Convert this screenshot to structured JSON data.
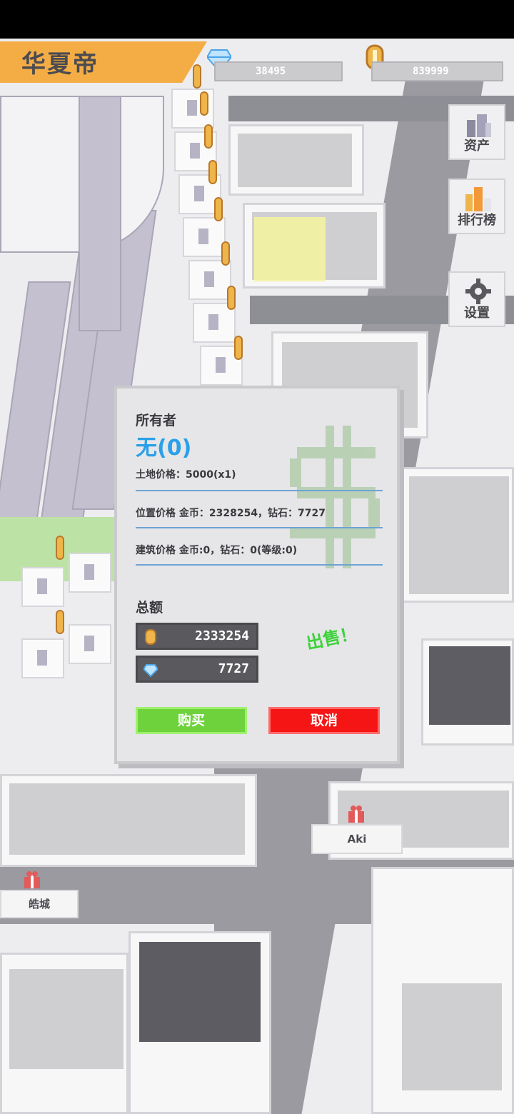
{
  "header": {
    "title": "华夏帝"
  },
  "resources": {
    "diamonds": "38495",
    "coins": "839999"
  },
  "side_menu": {
    "assets_label": "资产",
    "leaderboard_label": "排行榜",
    "settings_label": "设置"
  },
  "map_labels": {
    "player_aki": "Aki",
    "player_haocheng": "皓城"
  },
  "dialog": {
    "owner_label": "所有者",
    "owner_value": "无(0)",
    "land_price": "土地价格：5000(x1)",
    "location_price": "位置价格 金币：2328254，钻石：7727",
    "building_price": "建筑价格 金币:0，钻石：0(等级:0)",
    "total_label": "总额",
    "total_coins": "2333254",
    "total_diamonds": "7727",
    "sell_label": "出售！",
    "buy_button": "购买",
    "cancel_button": "取消"
  },
  "colors": {
    "banner": "#f4ad45",
    "buy": "#6ed23c",
    "cancel": "#f51515",
    "owner": "#2aa0e8",
    "sell": "#3cd23a"
  }
}
